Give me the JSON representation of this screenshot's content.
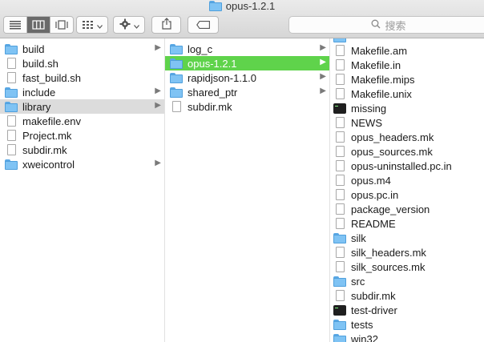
{
  "window": {
    "title": "opus-1.2.1"
  },
  "toolbar": {
    "view_icons": [
      "list-view-icon",
      "column-view-icon",
      "cover-flow-icon"
    ],
    "search": {
      "placeholder": "搜索"
    },
    "colors": {
      "accent": "#5fd34b",
      "folder": "#7fc3f4",
      "selected_gray": "#dcdcdc"
    }
  },
  "columns": {
    "col1": [
      {
        "name": "build",
        "kind": "folder",
        "chevron": "▶"
      },
      {
        "name": "build.sh",
        "kind": "file"
      },
      {
        "name": "fast_build.sh",
        "kind": "file"
      },
      {
        "name": "include",
        "kind": "folder",
        "chevron": "▶"
      },
      {
        "name": "library",
        "kind": "folder",
        "chevron": "▶",
        "selected": "gray"
      },
      {
        "name": "makefile.env",
        "kind": "file"
      },
      {
        "name": "Project.mk",
        "kind": "file"
      },
      {
        "name": "subdir.mk",
        "kind": "file"
      },
      {
        "name": "xweicontrol",
        "kind": "folder",
        "chevron": "▶"
      }
    ],
    "col2": [
      {
        "name": "log_c",
        "kind": "folder",
        "chevron": "▶"
      },
      {
        "name": "opus-1.2.1",
        "kind": "folder",
        "chevron": "▶",
        "selected": "green"
      },
      {
        "name": "rapidjson-1.1.0",
        "kind": "folder",
        "chevron": "▶"
      },
      {
        "name": "shared_ptr",
        "kind": "folder",
        "chevron": "▶"
      },
      {
        "name": "subdir.mk",
        "kind": "file"
      }
    ],
    "col3": [
      {
        "name": "Makefile.am",
        "kind": "file"
      },
      {
        "name": "Makefile.in",
        "kind": "file"
      },
      {
        "name": "Makefile.mips",
        "kind": "file"
      },
      {
        "name": "Makefile.unix",
        "kind": "file"
      },
      {
        "name": "missing",
        "kind": "exec"
      },
      {
        "name": "NEWS",
        "kind": "file"
      },
      {
        "name": "opus_headers.mk",
        "kind": "file"
      },
      {
        "name": "opus_sources.mk",
        "kind": "file"
      },
      {
        "name": "opus-uninstalled.pc.in",
        "kind": "file"
      },
      {
        "name": "opus.m4",
        "kind": "file"
      },
      {
        "name": "opus.pc.in",
        "kind": "file"
      },
      {
        "name": "package_version",
        "kind": "file"
      },
      {
        "name": "README",
        "kind": "file"
      },
      {
        "name": "silk",
        "kind": "folder"
      },
      {
        "name": "silk_headers.mk",
        "kind": "file"
      },
      {
        "name": "silk_sources.mk",
        "kind": "file"
      },
      {
        "name": "src",
        "kind": "folder"
      },
      {
        "name": "subdir.mk",
        "kind": "file"
      },
      {
        "name": "test-driver",
        "kind": "exec"
      },
      {
        "name": "tests",
        "kind": "folder"
      },
      {
        "name": "win32",
        "kind": "folder"
      }
    ]
  }
}
